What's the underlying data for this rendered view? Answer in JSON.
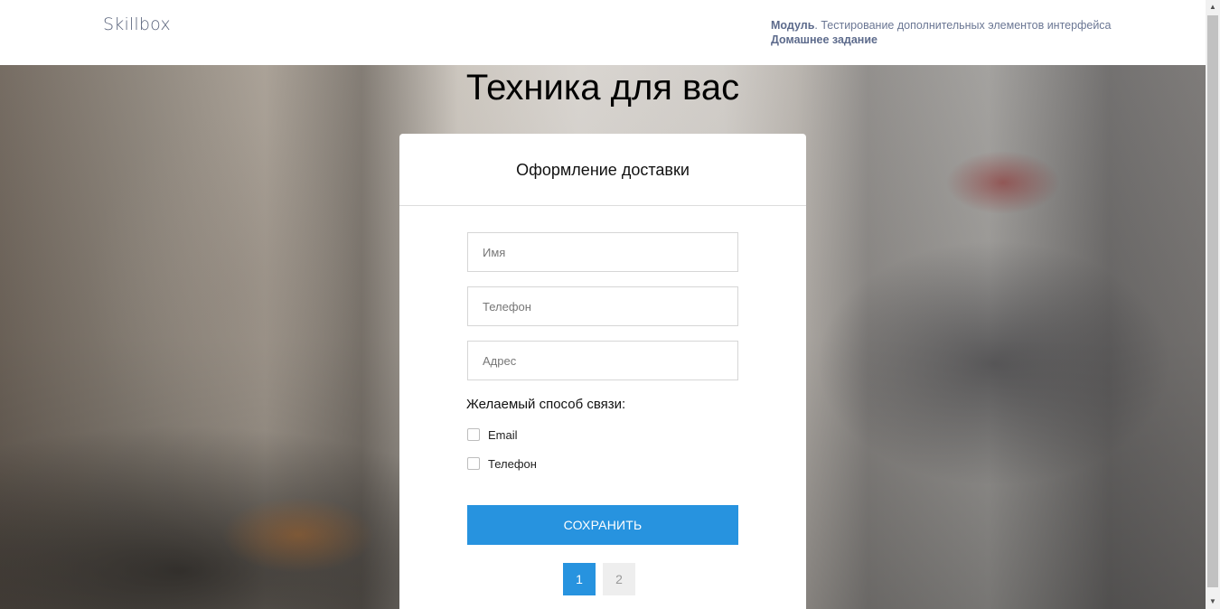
{
  "header": {
    "logo": "Skillbox",
    "module_label": "Модуль",
    "module_text": ". Тестирование дополнительных элементов интерфейса",
    "homework": "Домашнее задание"
  },
  "page": {
    "title": "Техника для вас"
  },
  "form": {
    "title": "Оформление доставки",
    "name_placeholder": "Имя",
    "phone_placeholder": "Телефон",
    "address_placeholder": "Адрес",
    "contact_label": "Желаемый способ связи:",
    "options": [
      {
        "label": "Email",
        "checked": false
      },
      {
        "label": "Телефон",
        "checked": false
      }
    ],
    "save_label": "СОХРАНИТЬ"
  },
  "pagination": {
    "pages": [
      "1",
      "2"
    ],
    "current": "1"
  },
  "colors": {
    "accent": "#2793df",
    "header_text": "#5d6b8c"
  },
  "icons": {
    "scroll_up": "triangle-up-icon",
    "scroll_down": "triangle-down-icon"
  }
}
